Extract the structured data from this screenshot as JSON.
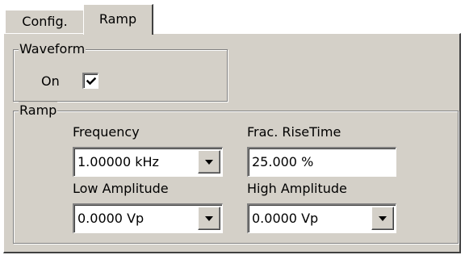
{
  "tabs": [
    {
      "label": "Config."
    },
    {
      "label": "Ramp"
    }
  ],
  "waveform": {
    "title": "Waveform",
    "on_label": "On",
    "on_checked": true
  },
  "ramp": {
    "title": "Ramp",
    "frequency": {
      "label": "Frequency",
      "value": "1.00000 kHz"
    },
    "frac_rise_time": {
      "label": "Frac. RiseTime",
      "value": "25.000 %"
    },
    "low_amplitude": {
      "label": "Low Amplitude",
      "value": "0.0000 Vp"
    },
    "high_amplitude": {
      "label": "High Amplitude",
      "value": "0.0000 Vp"
    }
  },
  "icons": {
    "checkbox": "check-icon",
    "dropdown": "chevron-down-icon"
  },
  "colors": {
    "face": "#d4d0c8",
    "shadow": "#808080",
    "highlight": "#ffffff",
    "dark_shadow": "#404040"
  }
}
